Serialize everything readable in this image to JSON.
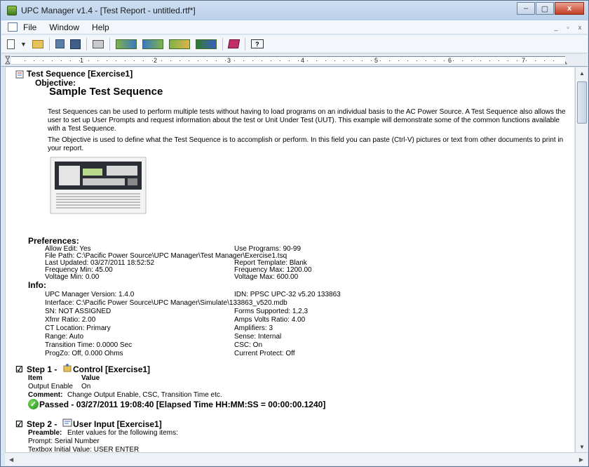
{
  "window": {
    "title": "UPC Manager v1.4 - [Test Report - untitled.rtf*]",
    "controls": {
      "minimize": "–",
      "maximize": "▢",
      "close": "x"
    }
  },
  "menu": {
    "items": [
      "File",
      "Window",
      "Help"
    ],
    "mdi": {
      "minimize": "_",
      "restore": "▫",
      "close": "x"
    }
  },
  "toolbar": {
    "help_label": "?"
  },
  "ruler": {
    "numbers": [
      "1",
      "2",
      "3",
      "4",
      "5",
      "6",
      "7"
    ]
  },
  "report": {
    "title": "Test Sequence [Exercise1]",
    "objective_label": "Objective:",
    "sample_heading": "Sample Test Sequence",
    "para1": "Test Sequences can be used to perform multiple tests without having to load programs on an individual basis to the AC Power Source. A Test Sequence also allows the user to set up User Prompts and request information about the test or Unit Under Test (UUT). This example will demonstrate some of the common functions available with a Test Sequence.",
    "para2": "The Objective is used to define what the Test Sequence is to accomplish or perform. In this field you can paste (Ctrl-V) pictures or text from other documents to print in your report.",
    "preferences_label": "Preferences:",
    "preferences_left": [
      "Allow Edit: Yes",
      "File Path: C:\\Pacific Power Source\\UPC Manager\\Test Manager\\Exercise1.tsq",
      "Last Updated: 03/27/2011 18:52:52",
      "Frequency Min: 45.00",
      "Voltage Min: 0.00"
    ],
    "preferences_right": [
      "Use Programs: 90-99",
      "",
      "Report Template: Blank",
      "Frequency Max: 1200.00",
      "Voltage Max: 600.00"
    ],
    "info_label": "Info:",
    "info_left": [
      "UPC Manager Version: 1.4.0",
      "Interface: C:\\Pacific Power Source\\UPC Manager\\Simulate\\133863_v520.mdb",
      "SN: NOT ASSIGNED",
      "Xfmr Ratio: 2.00",
      "CT Location: Primary",
      "Range: Auto",
      "Transition Time: 0.0000 Sec",
      "ProgZo: Off, 0.000 Ohms"
    ],
    "info_right": [
      "IDN: PPSC UPC-32 v5.20 133863",
      "",
      "Forms Supported: 1,2,3",
      "Amps Volts Ratio: 4.00",
      "Amplifiers: 3",
      "Sense: Internal",
      "CSC: On",
      "Current Protect: Off"
    ],
    "step1": {
      "check": "☑",
      "title": "Step 1 - ",
      "name": "Control [Exercise1]",
      "col_item": "Item",
      "col_value": "Value",
      "row_item": "Output Enable",
      "row_value": "On",
      "comment_label": "Comment:",
      "comment_text": "Change Output Enable, CSC, Transition Time etc.",
      "result": "Passed - 03/27/2011 19:08:40 [Elapsed Time HH:MM:SS = 00:00:00.1240]"
    },
    "step2": {
      "check": "☑",
      "title": "Step 2 - ",
      "name": "User Input [Exercise1]",
      "preamble_label": "Preamble:",
      "preamble_text": "Enter values for the following items:",
      "line1": "Prompt: Serial Number",
      "line2": "Textbox Initial Value: USER ENTER"
    }
  },
  "colors": {
    "titlebar": "#b9cfe9",
    "close_button": "#c43b22",
    "pass_green": "#1f8a1f"
  }
}
